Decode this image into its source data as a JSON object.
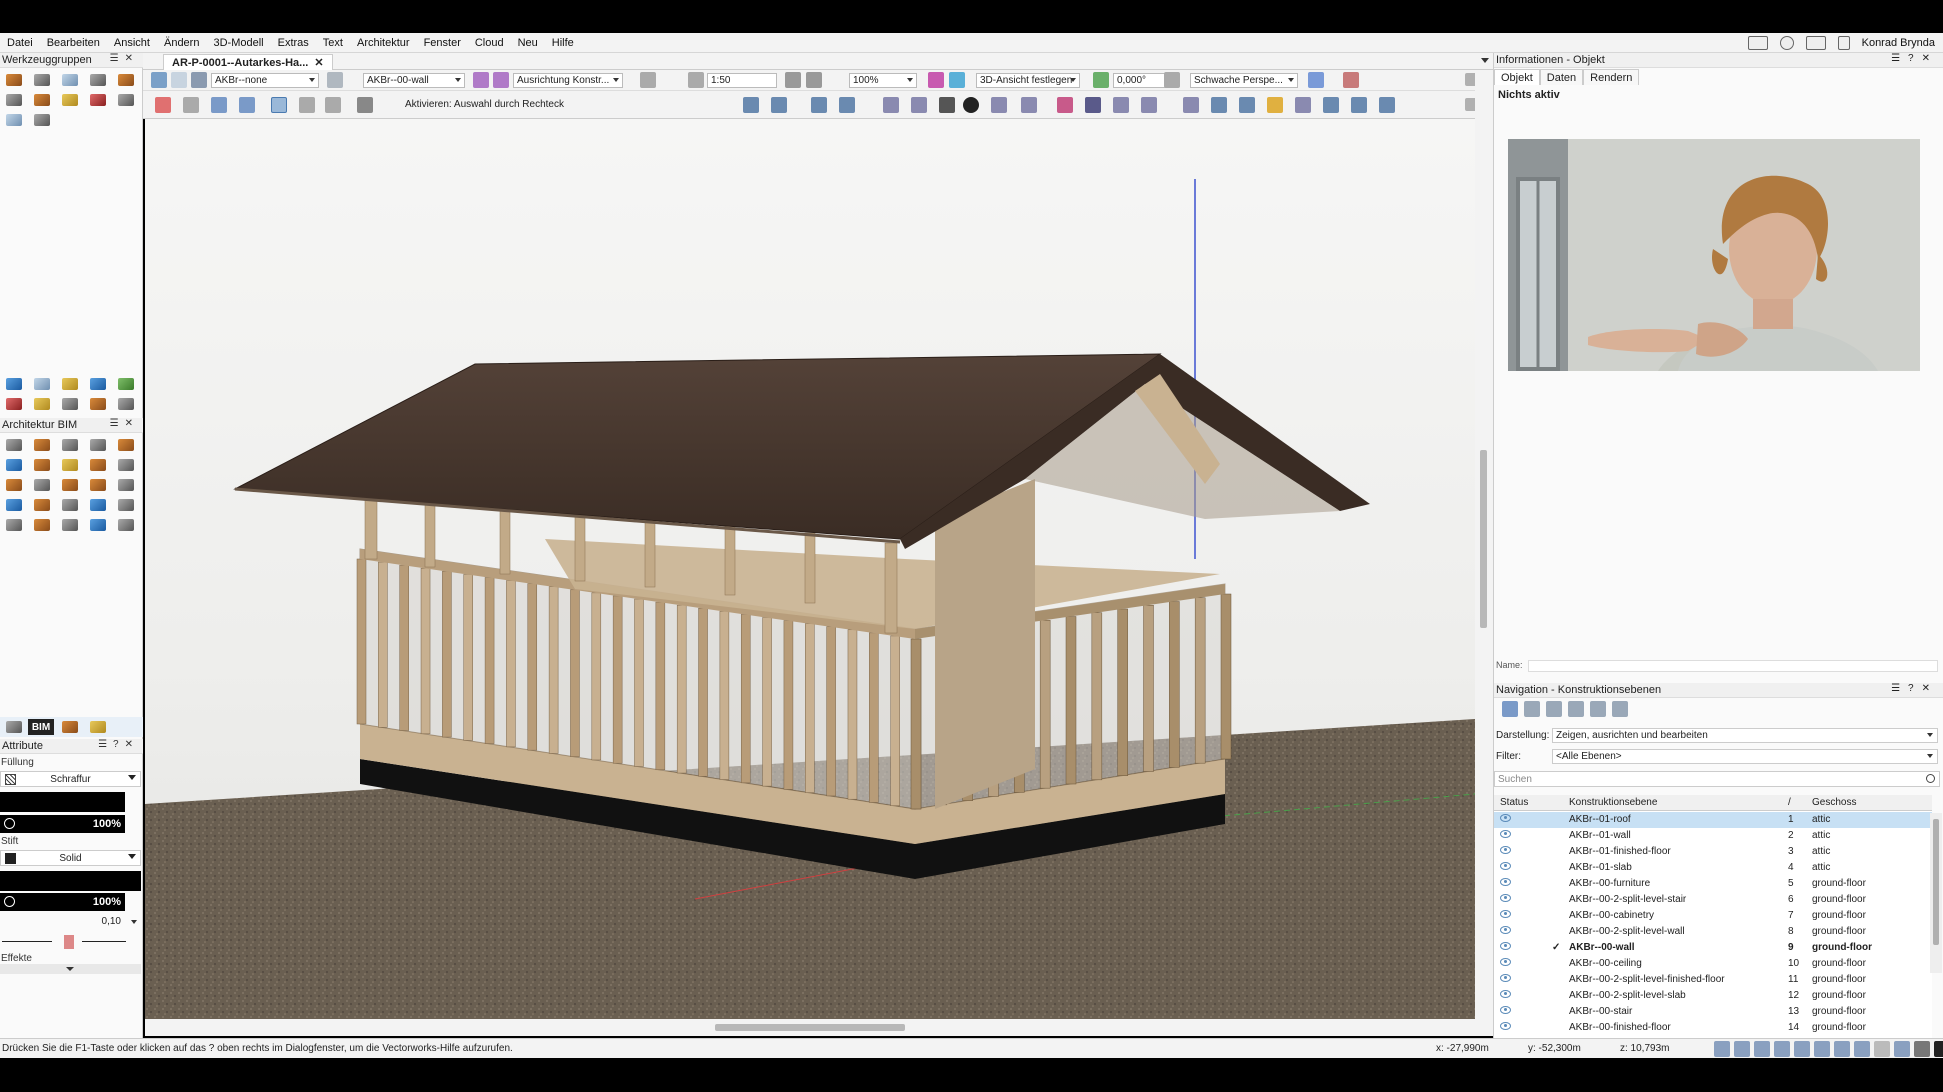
{
  "menu": [
    "Datei",
    "Bearbeiten",
    "Ansicht",
    "Ändern",
    "3D-Modell",
    "Extras",
    "Text",
    "Architektur",
    "Fenster",
    "Cloud",
    "Neu",
    "Hilfe"
  ],
  "user": "Konrad Brynda",
  "left": {
    "palette1_title": "Werkzeuggruppen",
    "palette2_title": "Architektur BIM",
    "bim_tab": "BIM",
    "attr_title": "Attribute",
    "fill_label": "Füllung",
    "fill_type": "Schraffur",
    "fill_opacity": "100%",
    "pen_label": "Stift",
    "pen_type": "Solid",
    "pen_opacity": "100%",
    "line_weight": "0,10",
    "effects_label": "Effekte"
  },
  "document": {
    "tab_title": "AR-P-0001--Autarkes-Ha...",
    "class_value": "AKBr--none",
    "layer_value": "AKBr--00-wall",
    "alignment_value": "Ausrichtung Konstr...",
    "scale_value": "1:50",
    "zoom_value": "100%",
    "view_value": "3D-Ansicht festlegen",
    "angle_value": "0,000°",
    "perspective_value": "Schwache Perspe...",
    "mode_text": "Aktivieren: Auswahl durch Rechteck"
  },
  "info": {
    "title": "Informationen - Objekt",
    "tabs": [
      "Objekt",
      "Daten",
      "Rendern"
    ],
    "state": "Nichts aktiv",
    "name_label": "Name:"
  },
  "nav": {
    "title": "Navigation - Konstruktionsebenen",
    "display_label": "Darstellung:",
    "display_value": "Zeigen, ausrichten und bearbeiten",
    "filter_label": "Filter:",
    "filter_value": "<Alle Ebenen>",
    "search_placeholder": "Suchen",
    "columns": {
      "status": "Status",
      "layer": "Konstruktionsebene",
      "order": "/",
      "story": "Geschoss"
    },
    "rows": [
      {
        "layer": "AKBr--01-roof",
        "order": "1",
        "story": "attic"
      },
      {
        "layer": "AKBr--01-wall",
        "order": "2",
        "story": "attic"
      },
      {
        "layer": "AKBr--01-finished-floor",
        "order": "3",
        "story": "attic"
      },
      {
        "layer": "AKBr--01-slab",
        "order": "4",
        "story": "attic"
      },
      {
        "layer": "AKBr--00-furniture",
        "order": "5",
        "story": "ground-floor"
      },
      {
        "layer": "AKBr--00-2-split-level-stair",
        "order": "6",
        "story": "ground-floor"
      },
      {
        "layer": "AKBr--00-cabinetry",
        "order": "7",
        "story": "ground-floor"
      },
      {
        "layer": "AKBr--00-2-split-level-wall",
        "order": "8",
        "story": "ground-floor"
      },
      {
        "layer": "AKBr--00-wall",
        "order": "9",
        "story": "ground-floor",
        "active": "✓"
      },
      {
        "layer": "AKBr--00-ceiling",
        "order": "10",
        "story": "ground-floor"
      },
      {
        "layer": "AKBr--00-2-split-level-finished-floor",
        "order": "11",
        "story": "ground-floor"
      },
      {
        "layer": "AKBr--00-2-split-level-slab",
        "order": "12",
        "story": "ground-floor"
      },
      {
        "layer": "AKBr--00-stair",
        "order": "13",
        "story": "ground-floor"
      },
      {
        "layer": "AKBr--00-finished-floor",
        "order": "14",
        "story": "ground-floor"
      }
    ]
  },
  "status": {
    "help_text": "Drücken Sie die F1-Taste oder klicken auf das ? oben rechts im Dialogfenster, um die Vectorworks-Hilfe aufzurufen.",
    "x": "x: -27,990m",
    "y": "y: -52,300m",
    "z": "z: 10,793m"
  }
}
